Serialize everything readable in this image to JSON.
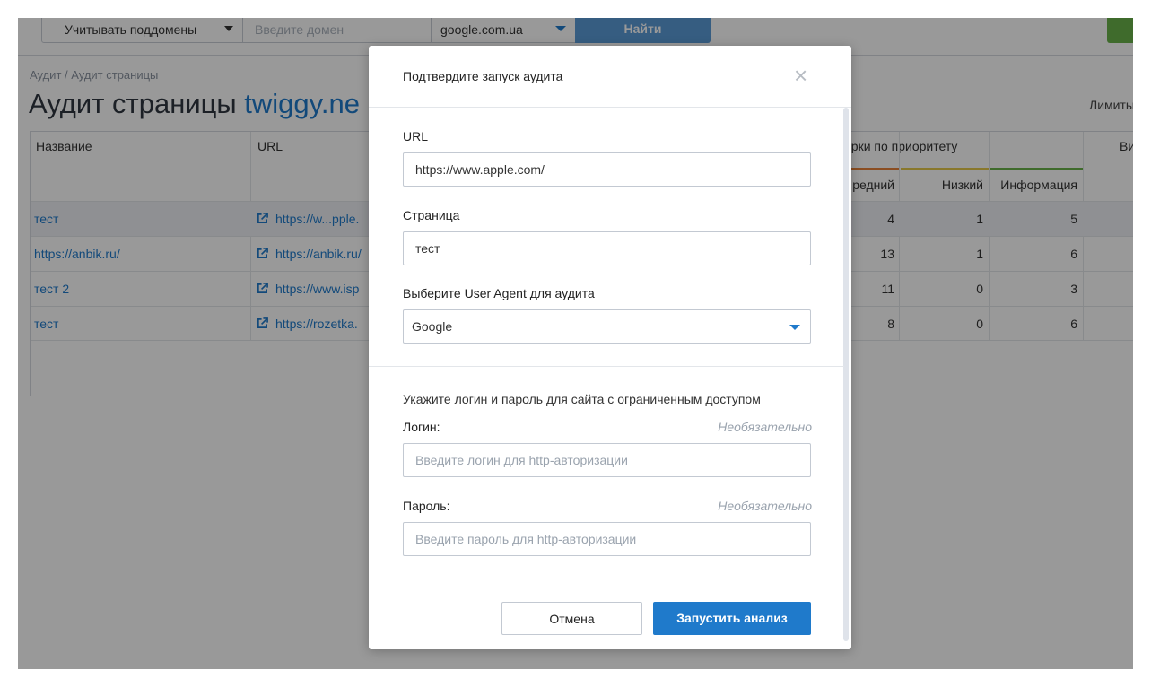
{
  "toolbar": {
    "subdomain_select": "Учитывать поддомены",
    "domain_placeholder": "Введите домен",
    "region_select": "google.com.ua",
    "find_button": "Найти"
  },
  "breadcrumb": "Аудит / Аудит страницы",
  "page_title": {
    "prefix": "Аудит страницы",
    "domain": "twiggy.ne"
  },
  "limit_text": "Лимиты",
  "table": {
    "headers": {
      "name": "Название",
      "url": "URL",
      "priority_group": "ерки по приоритету",
      "view": "Ви"
    },
    "subheaders": {
      "medium": "редний",
      "low": "Низкий",
      "info": "Информация"
    },
    "rows": [
      {
        "name": "тест",
        "url": "https://w...pple.",
        "medium": "4",
        "low": "1",
        "info": "5"
      },
      {
        "name": "https://anbik.ru/",
        "url": "https://anbik.ru/",
        "medium": "13",
        "low": "1",
        "info": "6"
      },
      {
        "name": "тест 2",
        "url": "https://www.isp",
        "medium": "11",
        "low": "0",
        "info": "3"
      },
      {
        "name": "тест",
        "url": "https://rozetka.",
        "medium": "8",
        "low": "0",
        "info": "6"
      }
    ]
  },
  "modal": {
    "title": "Подтвердите запуск аудита",
    "close": "×",
    "url_label": "URL",
    "url_value": "https://www.apple.com/",
    "page_label": "Страница",
    "page_value": "тест",
    "agent_label": "Выберите User Agent для аудита",
    "agent_value": "Google",
    "auth_note": "Укажите логин и пароль для сайта с ограниченным доступом",
    "login_label": "Логин:",
    "login_optional": "Необязательно",
    "login_placeholder": "Введите логин для http-авторизации",
    "password_label": "Пароль:",
    "password_optional": "Необязательно",
    "password_placeholder": "Введите пароль для http-авторизации",
    "cancel_button": "Отмена",
    "run_button": "Запустить анализ"
  },
  "colors": {
    "accent": "#1f7acb",
    "bar_orange": "#e8833a",
    "bar_yellow": "#e5c84a",
    "bar_green": "#6ab34a"
  }
}
